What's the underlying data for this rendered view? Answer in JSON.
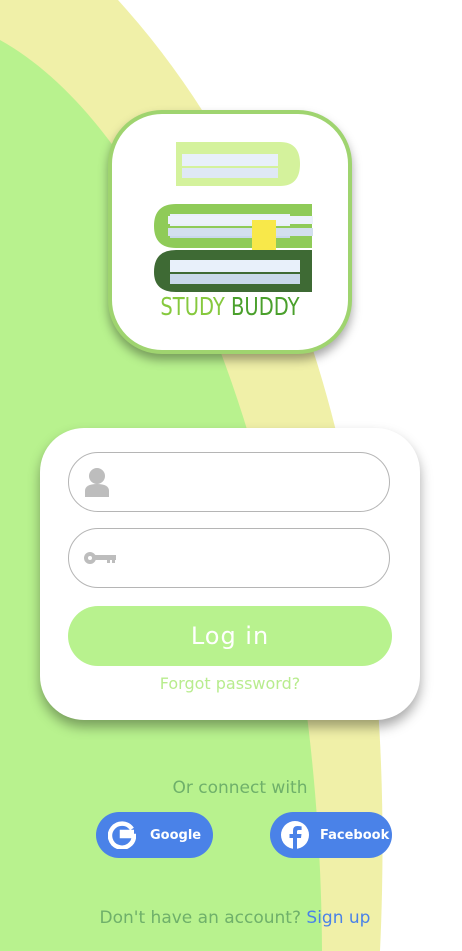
{
  "colors": {
    "green_light": "#b8f28e",
    "yellow_band": "#f0f0a8",
    "accent_blue": "#4a82e8",
    "text_green": "#6fb06a"
  },
  "logo": {
    "word1": "STUDY",
    "word2": "BUDDY",
    "icon": "stacked-books-icon"
  },
  "login": {
    "username_icon": "user-icon",
    "password_icon": "key-icon",
    "username_value": "",
    "password_value": "",
    "login_label": "Log in",
    "forgot_label": "Forgot password?"
  },
  "social": {
    "connect_label": "Or connect with",
    "google_label": "Google",
    "google_icon": "google-icon",
    "facebook_label": "Facebook",
    "facebook_icon": "facebook-icon"
  },
  "footer": {
    "prompt": "Don't have an account?",
    "signup_label": "Sign up"
  }
}
